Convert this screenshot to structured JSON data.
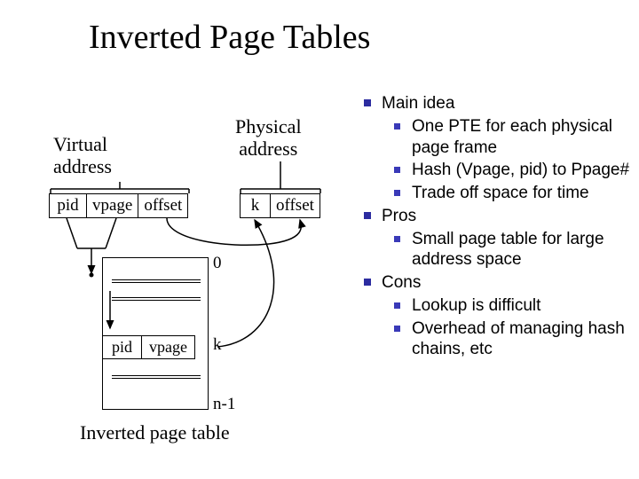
{
  "title": "Inverted Page Tables",
  "diagram": {
    "virtual_label": "Virtual\naddress",
    "physical_label": "Physical\naddress",
    "va": {
      "pid": "pid",
      "vpage": "vpage",
      "offset": "offset"
    },
    "pa": {
      "k": "k",
      "offset": "offset"
    },
    "ipt": {
      "caption": "Inverted page table",
      "entry_pid": "pid",
      "entry_vpage": "vpage",
      "k": "k",
      "zero": "0",
      "n_minus_1": "n-1"
    }
  },
  "bullets": {
    "main_idea": {
      "label": "Main idea",
      "items": [
        "One PTE for each physical page frame",
        "Hash (Vpage, pid) to Ppage#",
        "Trade off space for time"
      ]
    },
    "pros": {
      "label": "Pros",
      "items": [
        "Small page table for large address space"
      ]
    },
    "cons": {
      "label": "Cons",
      "items": [
        "Lookup is difficult",
        "Overhead of managing hash chains, etc"
      ]
    }
  }
}
